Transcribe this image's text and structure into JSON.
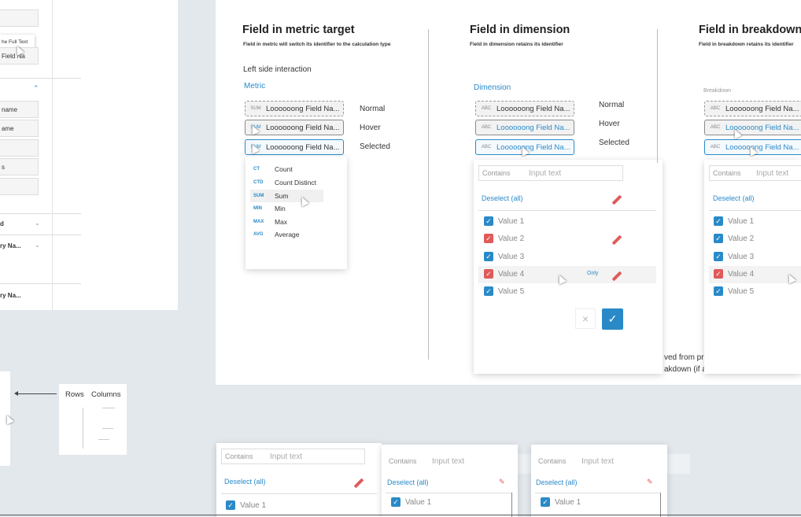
{
  "left_panel": {
    "tooltip": "he Full Text",
    "inputs": [
      "Field Na",
      "name",
      "ame",
      "",
      "s",
      ""
    ],
    "dropdowns": [
      "d",
      "ry Na...",
      "",
      "ry Na..."
    ]
  },
  "rows_columns_card": {
    "rows_label": "Rows",
    "columns_label": "Columns"
  },
  "metric": {
    "title": "Field in metric target",
    "subtitle": "Field in metric will switch its identifier to the calculation type",
    "left_side": "Left side  interaction",
    "section": "Metric",
    "fields": [
      {
        "tag": "SUM",
        "text": "Loooooong Field Na...",
        "state": "Normal"
      },
      {
        "tag": "SUM",
        "text": "Loooooong Field Na...",
        "state": "Hover"
      },
      {
        "tag": "SUM",
        "text": "Loooooong Field Na...",
        "state": "Selected"
      }
    ],
    "menu": [
      {
        "code": "CT",
        "label": "Count"
      },
      {
        "code": "CTD",
        "label": "Count Distinct"
      },
      {
        "code": "SUM",
        "label": "Sum"
      },
      {
        "code": "MIN",
        "label": "Min"
      },
      {
        "code": "MAX",
        "label": "Max"
      },
      {
        "code": "AVG",
        "label": "Average"
      }
    ]
  },
  "dimension": {
    "title": "Field in dimension",
    "subtitle": "Field in dimension retains its identifier",
    "section": "Dimension",
    "fields": [
      {
        "tag": "ABC",
        "text": "Loooooong Field Na...",
        "state": "Normal"
      },
      {
        "tag": "ABC",
        "text": "Loooooong Field Na...",
        "state": "Hover"
      },
      {
        "tag": "ABC",
        "text": "Loooooong Field Na...",
        "state": "Selected"
      }
    ],
    "filter": {
      "contains": "Contains",
      "input": "Input text",
      "deselect": "Deselect (all)",
      "values": [
        "Value 1",
        "Value 2",
        "Value 3",
        "Value 4",
        "Value 5"
      ],
      "only": "Only"
    }
  },
  "breakdown": {
    "title": "Field in breakdown c",
    "subtitle": "Field in breakdown retains its identifier",
    "section": "Breakdown",
    "fields": [
      {
        "tag": "ABC",
        "text": "Loooooong Field Na..."
      },
      {
        "tag": "ABC",
        "text": "Loooooong Field Na..."
      },
      {
        "tag": "ABC",
        "text": "Loooooong Field Na..."
      }
    ],
    "filter": {
      "contains": "Contains",
      "input": "Input text",
      "deselect": "Deselect (all)",
      "values": [
        "Value 1",
        "Value 2",
        "Value 3",
        "Value 4",
        "Value 5"
      ]
    },
    "note_line1": "ved from pri",
    "note_line2": "akdown (if a"
  },
  "bottom_filters": [
    {
      "contains": "Contains",
      "input": "Input text",
      "deselect": "Deselect (all)",
      "value": "Value 1"
    },
    {
      "contains": "Contains",
      "input": "Input text",
      "deselect": "Deselect (all)",
      "value": "Value 1"
    },
    {
      "contains": "Contains",
      "input": "Input text",
      "deselect": "Deselect (all)",
      "value": "Value 1"
    }
  ]
}
